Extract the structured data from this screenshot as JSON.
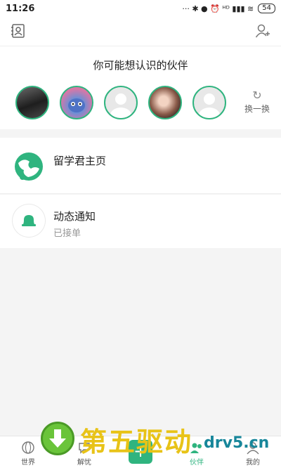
{
  "status_bar": {
    "time": "11:26",
    "signals": "··· ✱ ● ⏰ ᴴᴰ ▮▮▮ ≋",
    "battery": "54"
  },
  "people": {
    "title": "你可能想认识的伙伴",
    "swap_label": "换一换"
  },
  "rows": [
    {
      "title": "留学君主页",
      "subtitle": ""
    },
    {
      "title": "动态通知",
      "subtitle": "已接单"
    }
  ],
  "nav": {
    "tabs": [
      {
        "label": "世界",
        "icon": "globe-icon"
      },
      {
        "label": "解忧",
        "icon": "chat-icon"
      },
      {
        "label": "伙伴",
        "icon": "partner-icon"
      },
      {
        "label": "我的",
        "icon": "user-icon"
      }
    ],
    "post_symbol": "+"
  },
  "watermark": {
    "brand": "第五驱动",
    "site": "drv5.cn"
  },
  "colors": {
    "accent": "#2fb47f",
    "background": "#f4f4f4"
  }
}
